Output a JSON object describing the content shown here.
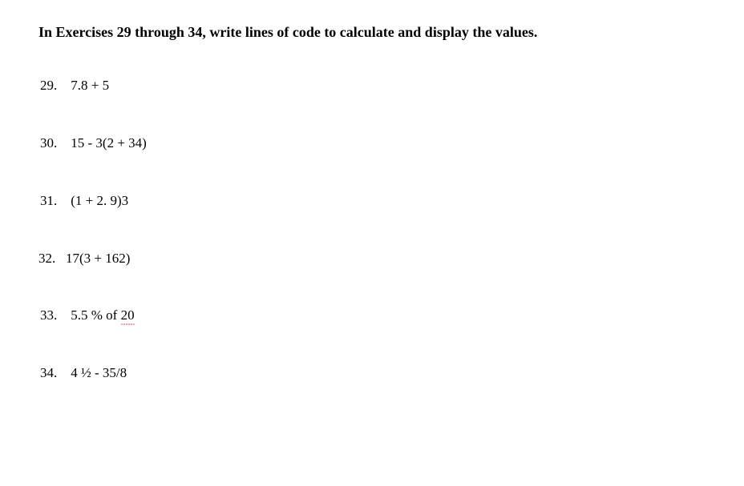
{
  "heading": "In Exercises 29 through 34, write lines of code to calculate and display the values.",
  "exercises": [
    {
      "number": "29.",
      "text": "7.8 + 5"
    },
    {
      "number": "30.",
      "text": "15 - 3(2 + 34)"
    },
    {
      "number": "31.",
      "text": "(1 + 2. 9)3"
    },
    {
      "number": "32.",
      "text": "17(3 + 162)"
    },
    {
      "number": "33.",
      "text_prefix": "5.5 % of ",
      "text_underlined": "20"
    },
    {
      "number": "34.",
      "text": "4 ½ - 35/8"
    }
  ]
}
